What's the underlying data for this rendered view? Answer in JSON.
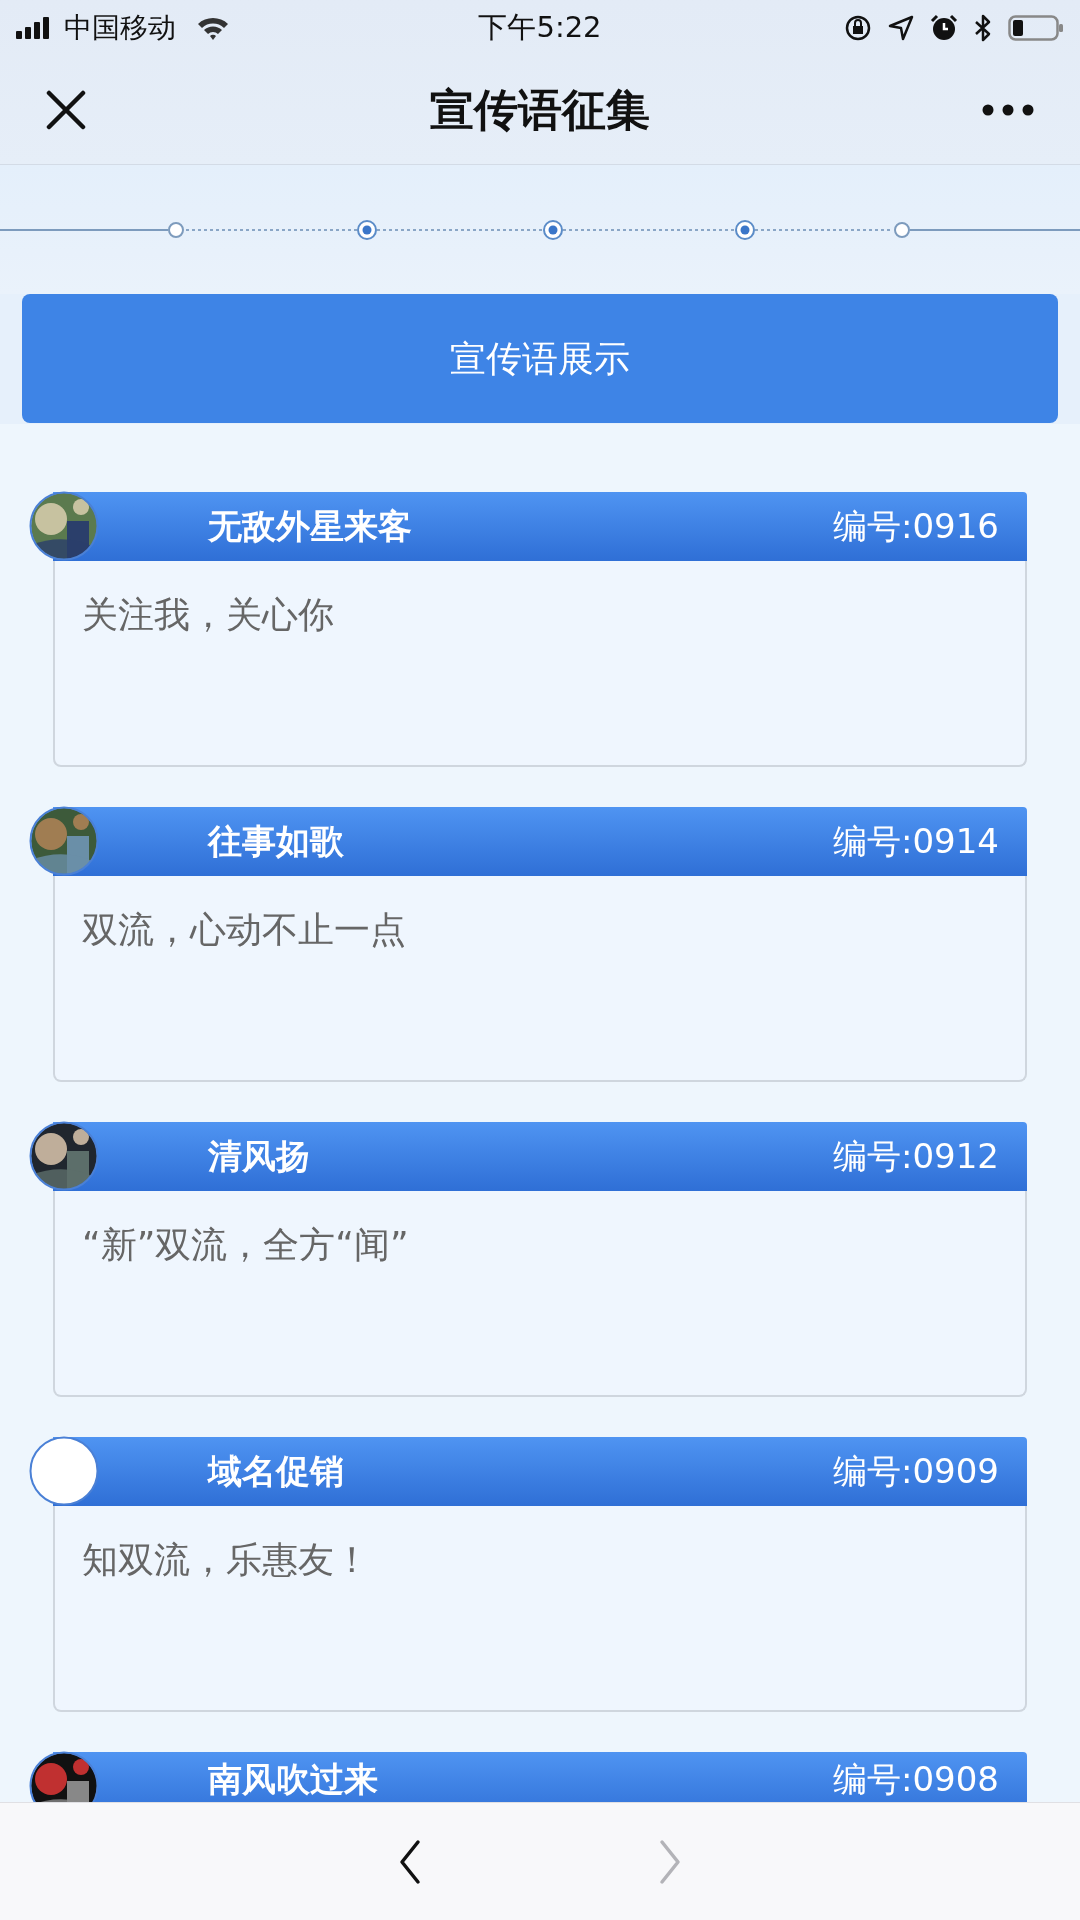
{
  "status_bar": {
    "carrier": "中国移动",
    "time": "下午5:22"
  },
  "nav": {
    "title": "宣传语征集"
  },
  "stepper": [
    {
      "active": false
    },
    {
      "active": true
    },
    {
      "active": true
    },
    {
      "active": true
    },
    {
      "active": false
    }
  ],
  "banner_button": {
    "label": "宣传语展示"
  },
  "entries": [
    {
      "name": "无敌外星来客",
      "number": "编号:0916",
      "slogan": "关注我，关心你"
    },
    {
      "name": "往事如歌",
      "number": "编号:0914",
      "slogan": "双流，心动不止一点"
    },
    {
      "name": "清风扬",
      "number": "编号:0912",
      "slogan": "“新”双流，全方“闻”"
    },
    {
      "avatar": {
        "kind": "blank"
      },
      "name": "域名促销",
      "number": "编号:0909",
      "slogan": "知双流，乐惠友！"
    },
    {
      "name": "南风吹过来",
      "number": "编号:0908"
    }
  ],
  "toolbar": {
    "back": {
      "disabled": false
    },
    "forward": {
      "disabled": true
    }
  }
}
